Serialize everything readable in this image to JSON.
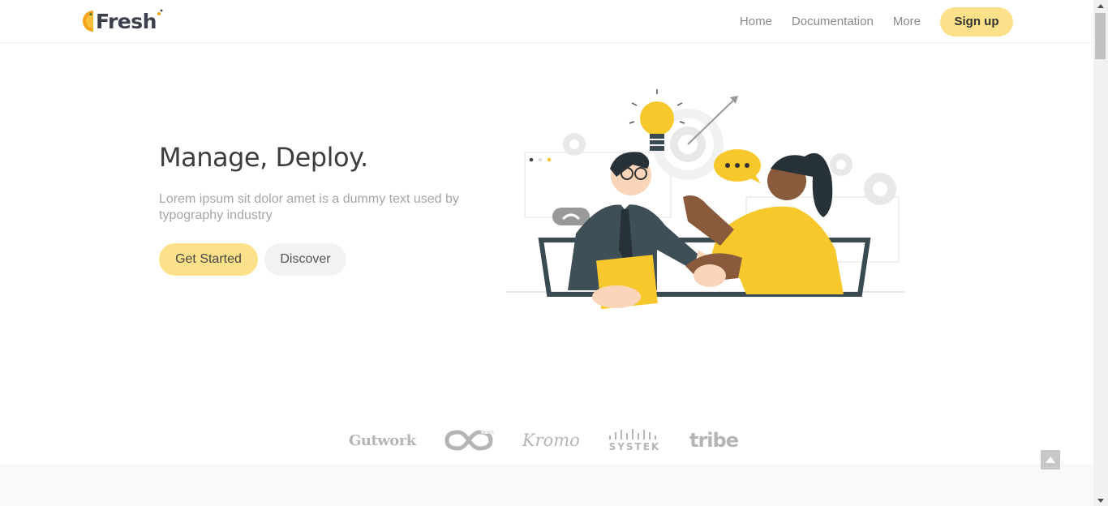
{
  "brand": {
    "name": "Fresh",
    "logo_icon": "half-orange-icon",
    "accent": "#fde18a",
    "logo_orange": "#f7a21b"
  },
  "nav": {
    "links": [
      "Home",
      "Documentation",
      "More"
    ],
    "signup_label": "Sign up"
  },
  "hero": {
    "title": "Manage, Deploy.",
    "subtitle": "Lorem ipsum sit dolor amet is a dummy text used by typography industry",
    "primary_label": "Get Started",
    "secondary_label": "Discover",
    "illustration": "handshake-illustration"
  },
  "clients": {
    "items": [
      {
        "name": "Gutwork",
        "icon": "gutwork-logo"
      },
      {
        "name": "infinite-logo",
        "icon": "infinity-logo"
      },
      {
        "name": "Kromo",
        "icon": "kromo-logo"
      },
      {
        "name": "SYSTEK",
        "icon": "systek-logo"
      },
      {
        "name": "tribe",
        "icon": "tribe-logo"
      }
    ]
  },
  "controls": {
    "back_to_top_icon": "caret-up-icon",
    "scrollbar_up_icon": "arrow-up-icon",
    "scrollbar_down_icon": "arrow-down-icon"
  }
}
